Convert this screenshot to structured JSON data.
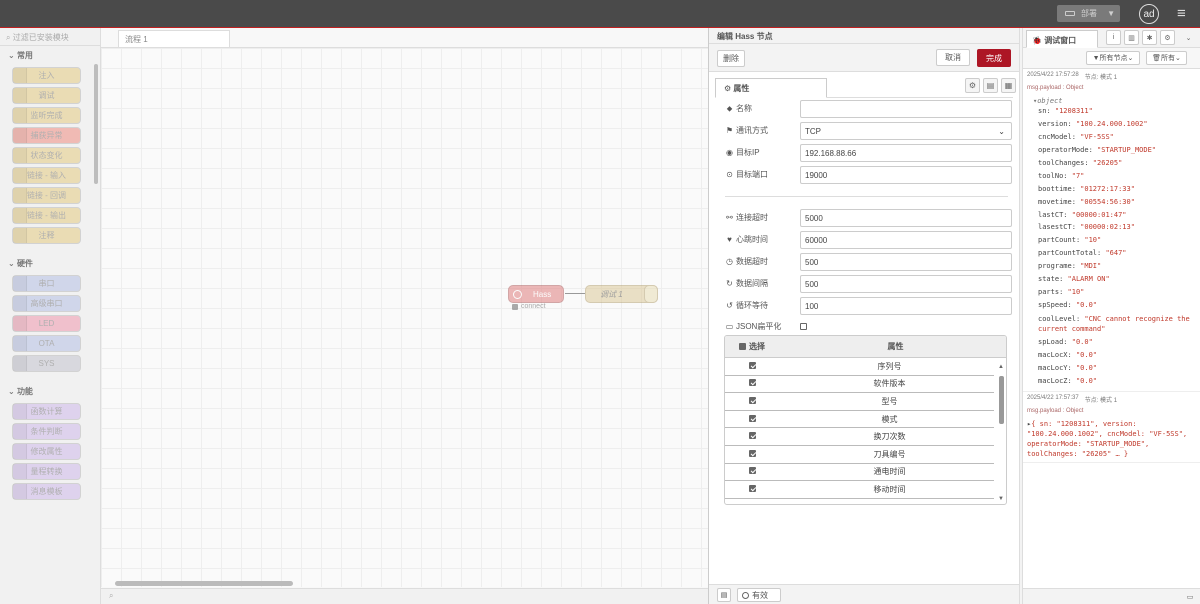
{
  "header": {
    "deploy_label": "部署",
    "avatar_text": "ad",
    "menu_icon": "hamburger-icon"
  },
  "palette": {
    "search_placeholder": "过滤已安装模块",
    "categories": {
      "common": "常用",
      "hardware": "硬件",
      "function": "功能"
    },
    "common_nodes": [
      "注入",
      "调试",
      "监听完成",
      "捕获异常",
      "状态变化",
      "链接 - 输入",
      "链接 - 回调",
      "链接 - 输出",
      "注释"
    ],
    "hardware_nodes": [
      "串口",
      "高级串口",
      "LED",
      "OTA",
      "SYS"
    ],
    "function_nodes": [
      "函数计算",
      "条件判断",
      "修改属性",
      "量程转换",
      "消息模板"
    ],
    "colors": {
      "common": "#e8d5a0",
      "common_alert": "#f0a8a0",
      "hardware": "#c5cde8",
      "led": "#f0b0c0",
      "sys": "#d0d0d8",
      "function": "#d8c8ec"
    }
  },
  "workspace": {
    "tab_label": "流程 1"
  },
  "flow": {
    "hass_node": {
      "label": "Hass",
      "status": "connect"
    },
    "debug_node": {
      "label": "调试 1"
    }
  },
  "editor": {
    "title": "编辑 Hass 节点",
    "delete_label": "删除",
    "cancel_label": "取消",
    "done_label": "完成",
    "tab_label": "属性",
    "fields": {
      "name": {
        "label": "名称",
        "value": ""
      },
      "protocol": {
        "label": "通讯方式",
        "value": "TCP"
      },
      "ip": {
        "label": "目标IP",
        "value": "192.168.88.66"
      },
      "port": {
        "label": "目标端口",
        "value": "19000"
      },
      "conn_timeout": {
        "label": "连接超时",
        "value": "5000"
      },
      "heartbeat": {
        "label": "心跳时间",
        "value": "60000"
      },
      "data_timeout": {
        "label": "数据超时",
        "value": "500"
      },
      "data_interval": {
        "label": "数据间隔",
        "value": "500"
      },
      "loop_wait": {
        "label": "循环等待",
        "value": "100"
      },
      "json_flatten": {
        "label": "JSON扁平化"
      }
    },
    "table": {
      "col_select": "选择",
      "col_attr": "属性",
      "rows": [
        "序列号",
        "软件版本",
        "型号",
        "模式",
        "换刀次数",
        "刀具编号",
        "通电时间",
        "移动时间"
      ]
    },
    "footer": {
      "enabled_label": "有效"
    }
  },
  "debug": {
    "tab_label": "调试窗口",
    "filter_nodes": "所有节点",
    "filter_all": "所有",
    "messages": [
      {
        "time": "2025/4/22 17:57:28",
        "node": "节点: 模式 1",
        "topic": "msg.payload : Object",
        "type": "object",
        "entries": [
          {
            "k": "sn",
            "v": "\"1208311\""
          },
          {
            "k": "version",
            "v": "\"100.24.000.1002\""
          },
          {
            "k": "cncModel",
            "v": "\"VF-5SS\""
          },
          {
            "k": "operatorMode",
            "v": "\"STARTUP_MODE\""
          },
          {
            "k": "toolChanges",
            "v": "\"26205\""
          },
          {
            "k": "toolNo",
            "v": "\"7\""
          },
          {
            "k": "boottime",
            "v": "\"01272:17:33\""
          },
          {
            "k": "movetime",
            "v": "\"00554:56:30\""
          },
          {
            "k": "lastCT",
            "v": "\"00000:01:47\""
          },
          {
            "k": "lasestCT",
            "v": "\"00000:02:13\""
          },
          {
            "k": "partCount",
            "v": "\"10\""
          },
          {
            "k": "partCountTotal",
            "v": "\"647\""
          },
          {
            "k": "programe",
            "v": "\"MDI\""
          },
          {
            "k": "state",
            "v": "\"ALARM ON\""
          },
          {
            "k": "parts",
            "v": "\"10\""
          },
          {
            "k": "spSpeed",
            "v": "\"0.0\""
          },
          {
            "k": "coolLevel",
            "v": "\"CNC cannot recognize the current command\""
          },
          {
            "k": "spLoad",
            "v": "\"0.0\""
          },
          {
            "k": "macLocX",
            "v": "\"0.0\""
          },
          {
            "k": "macLocY",
            "v": "\"0.0\""
          },
          {
            "k": "macLocZ",
            "v": "\"0.0\""
          }
        ]
      },
      {
        "time": "2025/4/22 17:57:37",
        "node": "节点: 模式 1",
        "topic": "msg.payload : Object",
        "summary": "{ sn: \"1208311\", version: \"100.24.000.1002\", cncModel: \"VF-5SS\", operatorMode: \"STARTUP_MODE\", toolChanges: \"26205\" … }"
      }
    ]
  }
}
